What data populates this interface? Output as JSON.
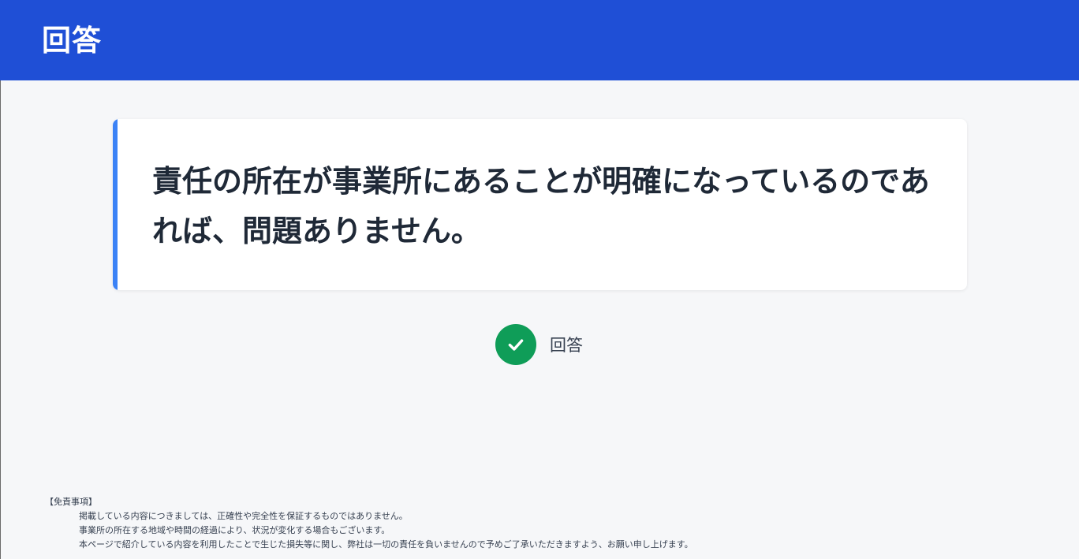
{
  "header": {
    "title": "回答"
  },
  "answer": {
    "text": "責任の所在が事業所にあることが明確になっているのであれば、問題ありません。"
  },
  "status": {
    "icon": "check-circle-icon",
    "label": "回答",
    "color": "#0f9d58"
  },
  "disclaimer": {
    "title": "【免責事項】",
    "lines": [
      "掲載している内容につきましては、正確性や完全性を保証するものではありません。",
      "事業所の所在する地域や時間の経過により、状況が変化する場合もございます。",
      "本ページで紹介している内容を利用したことで生じた損失等に関し、弊社は一切の責任を負いませんので予めご了承いただきますよう、お願い申し上げます。"
    ]
  },
  "colors": {
    "header_bg": "#1f4fd6",
    "accent": "#3b82f6",
    "page_bg": "#f6f7f9"
  }
}
